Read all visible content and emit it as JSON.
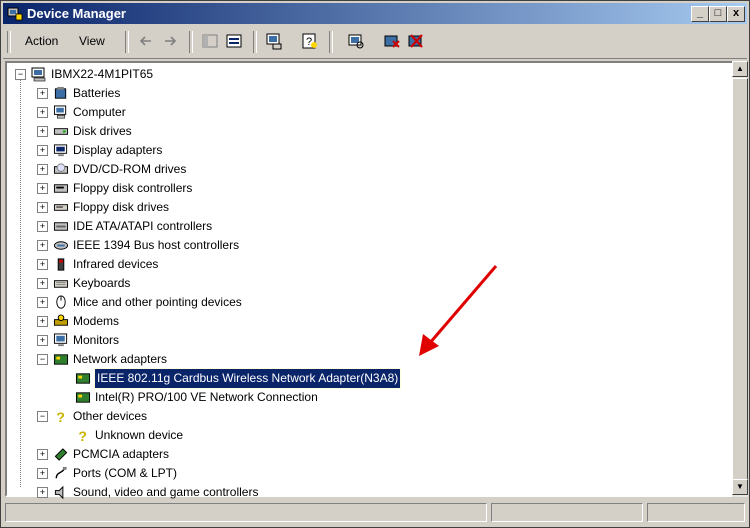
{
  "window": {
    "title": "Device Manager"
  },
  "title_buttons": {
    "minimize": "_",
    "maximize": "□",
    "close": "x"
  },
  "menu": {
    "action": "Action",
    "view": "View"
  },
  "toolbar_icons": [
    "back-icon",
    "forward-icon",
    "show-hide-icon",
    "properties-grid-icon",
    "computer-properties-icon",
    "help-icon",
    "scan-hardware-icon",
    "uninstall-icon",
    "disable-icon"
  ],
  "tree": {
    "root": "IBMX22-4M1PIT65",
    "nodes": [
      {
        "label": "Batteries",
        "icon": "battery-icon",
        "expander": "+"
      },
      {
        "label": "Computer",
        "icon": "computer-icon",
        "expander": "+"
      },
      {
        "label": "Disk drives",
        "icon": "disk-icon",
        "expander": "+"
      },
      {
        "label": "Display adapters",
        "icon": "display-icon",
        "expander": "+"
      },
      {
        "label": "DVD/CD-ROM drives",
        "icon": "cdrom-icon",
        "expander": "+"
      },
      {
        "label": "Floppy disk controllers",
        "icon": "floppy-controller-icon",
        "expander": "+"
      },
      {
        "label": "Floppy disk drives",
        "icon": "floppy-icon",
        "expander": "+"
      },
      {
        "label": "IDE ATA/ATAPI controllers",
        "icon": "ide-icon",
        "expander": "+"
      },
      {
        "label": "IEEE 1394 Bus host controllers",
        "icon": "firewire-icon",
        "expander": "+"
      },
      {
        "label": "Infrared devices",
        "icon": "infrared-icon",
        "expander": "+"
      },
      {
        "label": "Keyboards",
        "icon": "keyboard-icon",
        "expander": "+"
      },
      {
        "label": "Mice and other pointing devices",
        "icon": "mouse-icon",
        "expander": "+"
      },
      {
        "label": "Modems",
        "icon": "modem-icon",
        "expander": "+"
      },
      {
        "label": "Monitors",
        "icon": "monitor-icon",
        "expander": "+"
      },
      {
        "label": "Network adapters",
        "icon": "network-icon",
        "expander": "−"
      },
      {
        "label": "Other devices",
        "icon": "question-icon",
        "expander": "−"
      },
      {
        "label": "PCMCIA adapters",
        "icon": "pcmcia-icon",
        "expander": "+"
      },
      {
        "label": "Ports (COM & LPT)",
        "icon": "port-icon",
        "expander": "+"
      },
      {
        "label": "Sound, video and game controllers",
        "icon": "sound-icon",
        "expander": "+"
      }
    ],
    "network_children": [
      {
        "label": "IEEE 802.11g Cardbus Wireless Network Adapter(N3A8)",
        "selected": true
      },
      {
        "label": "Intel(R) PRO/100 VE Network Connection",
        "selected": false
      }
    ],
    "other_children": [
      {
        "label": "Unknown device"
      }
    ]
  },
  "annotation": {
    "arrow_color": "#e00000"
  },
  "colors": {
    "selection": "#0a246a",
    "titlebar": "#0a246a",
    "face": "#d4d0c8"
  }
}
